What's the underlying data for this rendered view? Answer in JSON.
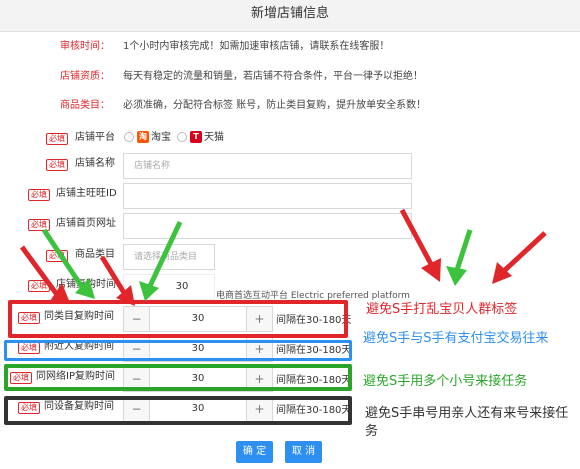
{
  "dialog": {
    "title": "新增店铺信息"
  },
  "notes": [
    {
      "key": "审核时间：",
      "value": "1个小时内审核完成！如需加速审核店铺，请联系在线客服！"
    },
    {
      "key": "店铺资质：",
      "value": "每天有稳定的流量和销量，若店铺不符合条件，平台一律予以拒绝！"
    },
    {
      "key": "商品类目：",
      "value": "必须准确，分配符合标签 账号，防止类目复购，提升放单安全系数！"
    }
  ],
  "required_badge": "必填",
  "form": {
    "platform_label": "店铺平台",
    "platform_options": [
      "淘宝",
      "天猫"
    ],
    "shop_name_label": "店铺名称",
    "shop_name_placeholder": "店铺名称",
    "wangwang_label": "店铺主旺旺ID",
    "homepage_label": "店铺首页网址",
    "category_label": "商品类目",
    "category_placeholder": "请选择商品类目",
    "repurchase_label": "店铺复购时间",
    "repurchase_value": "30",
    "category_repurchase_label": "同类目复购时间",
    "nearby_repurchase_label": "附近人复购时间",
    "ip_repurchase_label": "同网络IP复购时间",
    "device_repurchase_label": "同设备复购时间",
    "stepper_value": "30",
    "minus": "−",
    "plus": "+",
    "interval_hint": "间隔在30-180天"
  },
  "watermark": "电商首选互动平台 Electric preferred platform",
  "annotations": [
    "避免S手打乱宝贝人群标签",
    "避免S手与S手有支付宝交易往来",
    "避免S手用多个小号来接任务",
    "避免S手串号用亲人还有来号来接任务"
  ],
  "buttons": {
    "confirm": "确 定",
    "cancel": "取 消"
  },
  "colors": {
    "red": "#e0262b",
    "blue": "#2d8ff0",
    "green": "#2aa52a",
    "black": "#333333",
    "arrow_green": "#3cc23c"
  }
}
